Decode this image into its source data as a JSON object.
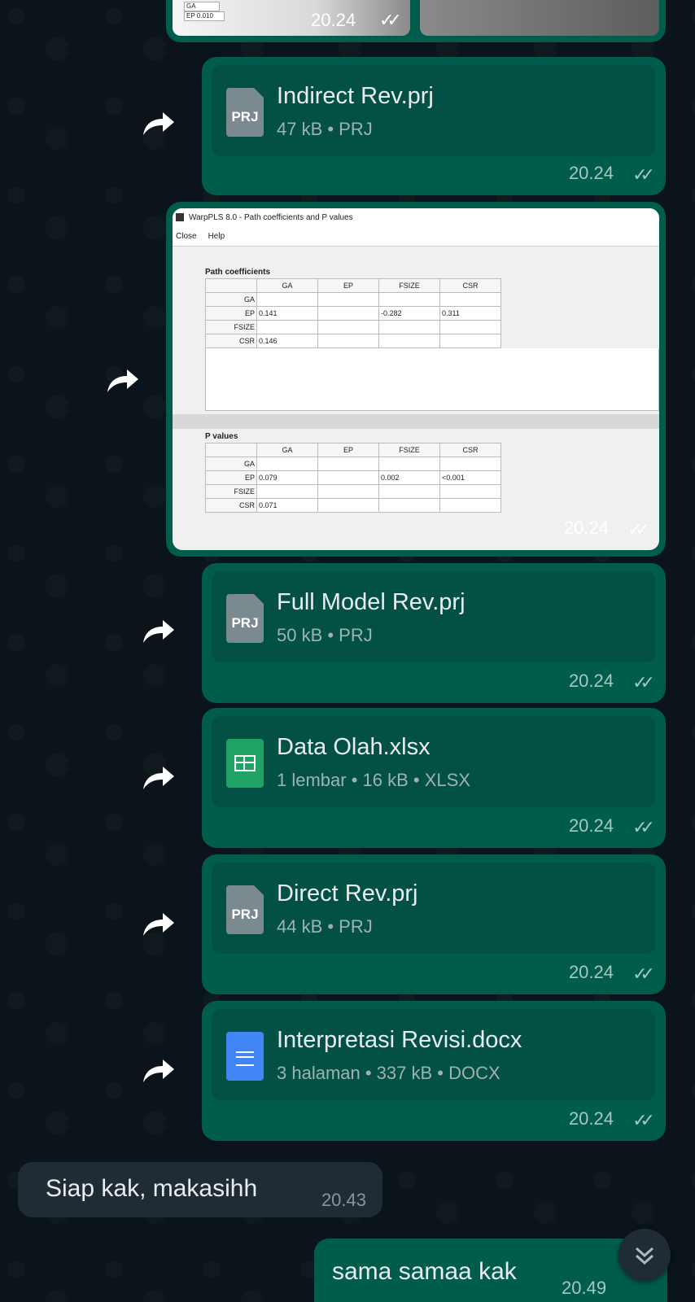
{
  "top_fragment": {
    "cell_ga": "GA",
    "cell_ep": "EP",
    "cell_val": "0.010",
    "time": "20.24",
    "ticks": "✓✓"
  },
  "files": [
    {
      "name": "Indirect Rev.prj",
      "meta": "47 kB • PRJ",
      "icon": "PRJ",
      "time": "20.24",
      "ticks": "✓✓"
    },
    {
      "name": "Full Model Rev.prj",
      "meta": "50 kB • PRJ",
      "icon": "PRJ",
      "time": "20.24",
      "ticks": "✓✓"
    },
    {
      "name": "Data Olah.xlsx",
      "meta": "1 lembar • 16 kB • XLSX",
      "icon": "xlsx",
      "time": "20.24",
      "ticks": "✓✓"
    },
    {
      "name": "Direct Rev.prj",
      "meta": "44 kB • PRJ",
      "icon": "PRJ",
      "time": "20.24",
      "ticks": "✓✓"
    },
    {
      "name": "Interpretasi Revisi.docx",
      "meta": "3 halaman • 337 kB • DOCX",
      "icon": "docx",
      "time": "20.24",
      "ticks": "✓✓"
    }
  ],
  "image_message": {
    "window_title": "WarpPLS 8.0 - Path coefficients and P values",
    "menu": [
      "Close",
      "Help"
    ],
    "path_title": "Path coefficients",
    "pvalues_title": "P values",
    "columns": [
      "GA",
      "EP",
      "FSIZE",
      "CSR"
    ],
    "path_rows": [
      {
        "label": "GA",
        "cells": [
          "",
          "",
          "",
          ""
        ]
      },
      {
        "label": "EP",
        "cells": [
          "0.141",
          "",
          "-0.282",
          "0.311"
        ]
      },
      {
        "label": "FSIZE",
        "cells": [
          "",
          "",
          "",
          ""
        ]
      },
      {
        "label": "CSR",
        "cells": [
          "0.146",
          "",
          "",
          ""
        ]
      }
    ],
    "p_rows": [
      {
        "label": "GA",
        "cells": [
          "",
          "",
          "",
          ""
        ]
      },
      {
        "label": "EP",
        "cells": [
          "0.079",
          "",
          "0.002",
          "<0.001"
        ]
      },
      {
        "label": "FSIZE",
        "cells": [
          "",
          "",
          "",
          ""
        ]
      },
      {
        "label": "CSR",
        "cells": [
          "0.071",
          "",
          "",
          ""
        ]
      }
    ],
    "time": "20.24",
    "ticks": "✓✓"
  },
  "incoming": {
    "text": "Siap kak, makasihh",
    "time": "20.43"
  },
  "outgoing_last": {
    "text": "sama samaa kak",
    "time": "20.49"
  },
  "colors": {
    "outgoing": "#005c4b",
    "incoming": "#202c33",
    "background": "#0b141a"
  }
}
